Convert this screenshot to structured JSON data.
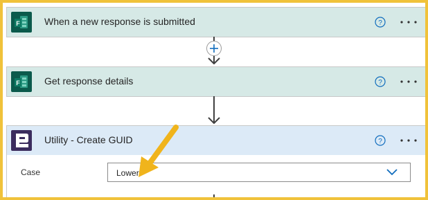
{
  "steps": [
    {
      "title": "When a new response is submitted",
      "icon": "microsoft-forms-icon",
      "help_icon": "help-icon",
      "more_icon": "more-options-icon"
    },
    {
      "title": "Get response details",
      "icon": "microsoft-forms-icon",
      "help_icon": "help-icon",
      "more_icon": "more-options-icon"
    },
    {
      "title": "Utility - Create GUID",
      "icon": "utility-icon",
      "help_icon": "help-icon",
      "more_icon": "more-options-icon",
      "fields": [
        {
          "label": "Case",
          "value": "Lower"
        }
      ]
    }
  ],
  "add_step": {
    "icon": "plus-icon"
  },
  "colors": {
    "frame": "#f0c23a",
    "forms_header": "#d6e9e6",
    "utility_header": "#dceaf7",
    "forms_icon": "#0b5a4c",
    "utility_icon": "#3b2c5e",
    "accent": "#0f6cbd",
    "annotation_arrow": "#f0b41c"
  }
}
